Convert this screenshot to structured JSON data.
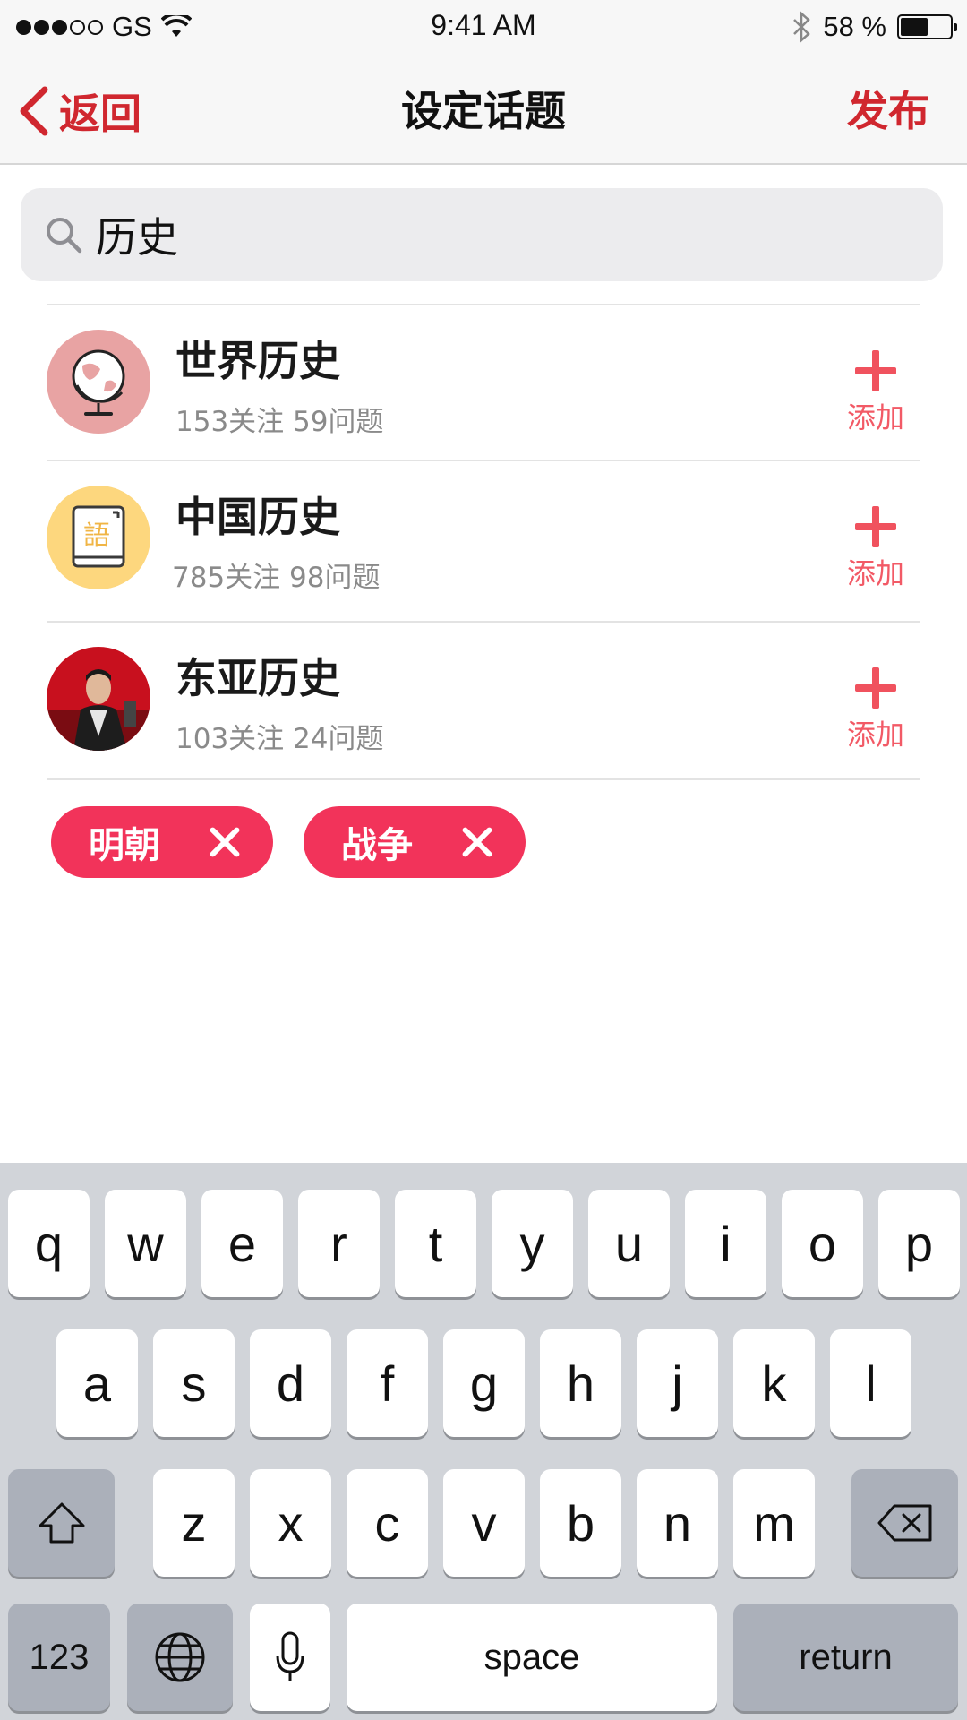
{
  "status_bar": {
    "carrier": "GS",
    "time": "9:41 AM",
    "battery_percent": "58 %",
    "battery_level": 0.58,
    "signal_bars": 3,
    "signal_total": 5
  },
  "nav": {
    "back_label": "返回",
    "title": "设定话题",
    "publish_label": "发布"
  },
  "search": {
    "value": "历史"
  },
  "topics": [
    {
      "name": "世界历史",
      "stats": "153关注 59问题",
      "add_label": "添加",
      "avatar_icon": "globe-icon"
    },
    {
      "name": "中国历史",
      "stats": "785关注 98问题",
      "add_label": "添加",
      "avatar_icon": "book-icon",
      "avatar_glyph": "語"
    },
    {
      "name": "东亚历史",
      "stats": "103关注 24问题",
      "add_label": "添加",
      "avatar_icon": "person-photo"
    }
  ],
  "tags": [
    {
      "label": "明朝"
    },
    {
      "label": "战争"
    }
  ],
  "keyboard": {
    "row1": [
      "q",
      "w",
      "e",
      "r",
      "t",
      "y",
      "u",
      "i",
      "o",
      "p"
    ],
    "row2": [
      "a",
      "s",
      "d",
      "f",
      "g",
      "h",
      "j",
      "k",
      "l"
    ],
    "row3": [
      "z",
      "x",
      "c",
      "v",
      "b",
      "n",
      "m"
    ],
    "numbers_label": "123",
    "space_label": "space",
    "return_label": "return"
  },
  "colors": {
    "accent": "#d0272f",
    "tag": "#f2335a",
    "add": "#f0525e"
  }
}
